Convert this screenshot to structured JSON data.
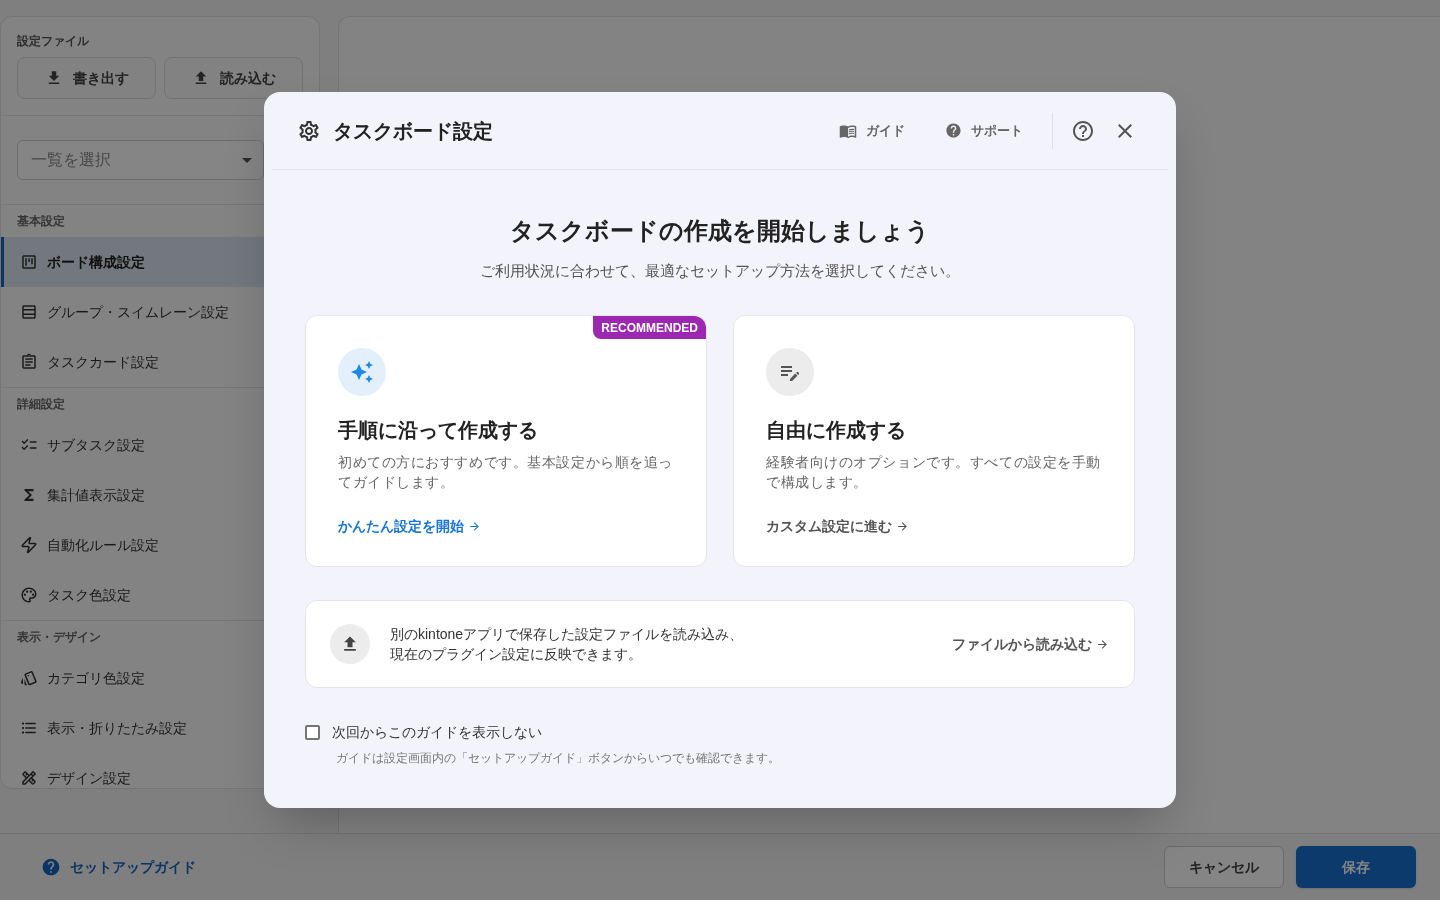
{
  "sidebar": {
    "settings_file": {
      "title": "設定ファイル",
      "buttons": [
        {
          "label": "書き出す",
          "kind": "export"
        },
        {
          "label": "読み込む",
          "kind": "import"
        }
      ]
    },
    "list_select": {
      "placeholder": "一覧を選択"
    },
    "sections": [
      {
        "title": "基本設定",
        "items": [
          {
            "label": "ボード構成設定",
            "kind": "board",
            "selected": true
          },
          {
            "label": "グループ・スイムレーン設定",
            "kind": "group",
            "selected": false
          },
          {
            "label": "タスクカード設定",
            "kind": "card",
            "selected": false
          }
        ]
      },
      {
        "title": "詳細設定",
        "items": [
          {
            "label": "サブタスク設定",
            "kind": "subtask",
            "selected": false
          },
          {
            "label": "集計値表示設定",
            "kind": "summary",
            "selected": false
          },
          {
            "label": "自動化ルール設定",
            "kind": "automation",
            "selected": false
          },
          {
            "label": "タスク色設定",
            "kind": "task_color",
            "selected": false
          }
        ]
      },
      {
        "title": "表示・デザイン",
        "items": [
          {
            "label": "カテゴリ色設定",
            "kind": "category_color",
            "selected": false
          },
          {
            "label": "表示・折りたたみ設定",
            "kind": "display",
            "selected": false
          },
          {
            "label": "デザイン設定",
            "kind": "design",
            "selected": false
          }
        ]
      }
    ]
  },
  "footer": {
    "guide_link": "セットアップガイド",
    "buttons": [
      {
        "label": "キャンセル",
        "kind": "secondary"
      },
      {
        "label": "保存",
        "kind": "primary"
      }
    ]
  },
  "dialog": {
    "title": "タスクボード設定",
    "header_links": [
      {
        "label": "ガイド",
        "kind": "guide"
      },
      {
        "label": "サポート",
        "kind": "support"
      }
    ],
    "heading": "タスクボードの作成を開始しましょう",
    "subheading": "ご利用状況に合わせて、最適なセットアップ方法を選択してください。",
    "options": [
      {
        "kind": "guided",
        "badge": "RECOMMENDED",
        "title": "手順に沿って作成する",
        "description": "初めての方におすすめです。基本設定から順を追ってガイドします。",
        "link": "かんたん設定を開始"
      },
      {
        "kind": "custom",
        "title": "自由に作成する",
        "description": "経験者向けのオプションです。すべての設定を手動で構成します。",
        "link": "カスタム設定に進む"
      }
    ],
    "import": {
      "lines": [
        "別のkintoneアプリで保存した設定ファイルを読み込み、",
        "現在のプラグイン設定に反映できます。"
      ],
      "link": "ファイルから読み込む"
    },
    "dont_show_again": {
      "label": "次回からこのガイドを表示しない",
      "checked": false
    },
    "note": "ガイドは設定画面内の「セットアップガイド」ボタンからいつでも確認できます。"
  }
}
